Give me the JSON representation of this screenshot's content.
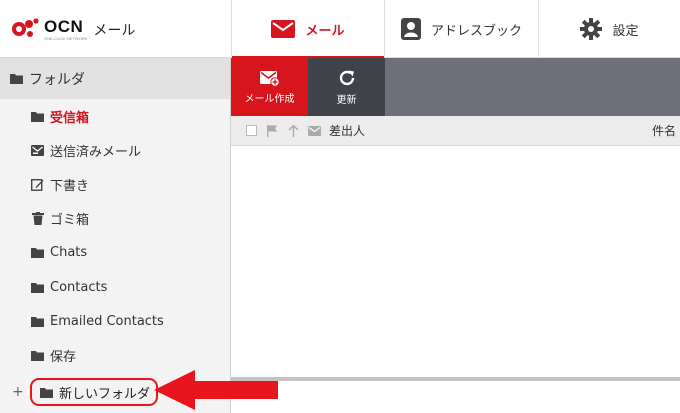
{
  "header": {
    "logo": {
      "brand": "OCN",
      "sub": "ONE-CLICK NETWORK",
      "product": "メール"
    },
    "tabs": [
      {
        "label": "メール",
        "icon": "envelope-icon",
        "active": true
      },
      {
        "label": "アドレスブック",
        "icon": "address-book-icon",
        "active": false
      },
      {
        "label": "設定",
        "icon": "gear-icon",
        "active": false
      }
    ]
  },
  "sidebar": {
    "title": "フォルダ",
    "folders": [
      {
        "label": "受信箱",
        "icon": "folder-icon",
        "active": true
      },
      {
        "label": "送信済みメール",
        "icon": "sent-mail-icon",
        "active": false
      },
      {
        "label": "下書き",
        "icon": "edit-icon",
        "active": false
      },
      {
        "label": "ゴミ箱",
        "icon": "trash-icon",
        "active": false
      },
      {
        "label": "Chats",
        "icon": "folder-icon",
        "active": false
      },
      {
        "label": "Contacts",
        "icon": "folder-icon",
        "active": false
      },
      {
        "label": "Emailed Contacts",
        "icon": "folder-icon",
        "active": false
      },
      {
        "label": "保存",
        "icon": "folder-icon",
        "active": false
      }
    ],
    "new_folder": {
      "plus": "+",
      "label": "新しいフォルダ"
    }
  },
  "toolbar": {
    "compose_label": "メール作成",
    "refresh_label": "更新"
  },
  "list": {
    "columns": {
      "sender": "差出人",
      "subject": "件名"
    }
  },
  "colors": {
    "accent": "#d6151d",
    "toolbar": "#6d7079",
    "refresh_bg": "#41434a",
    "sidebar_bg": "#f3f3f3",
    "annotation": "#e8141e"
  }
}
